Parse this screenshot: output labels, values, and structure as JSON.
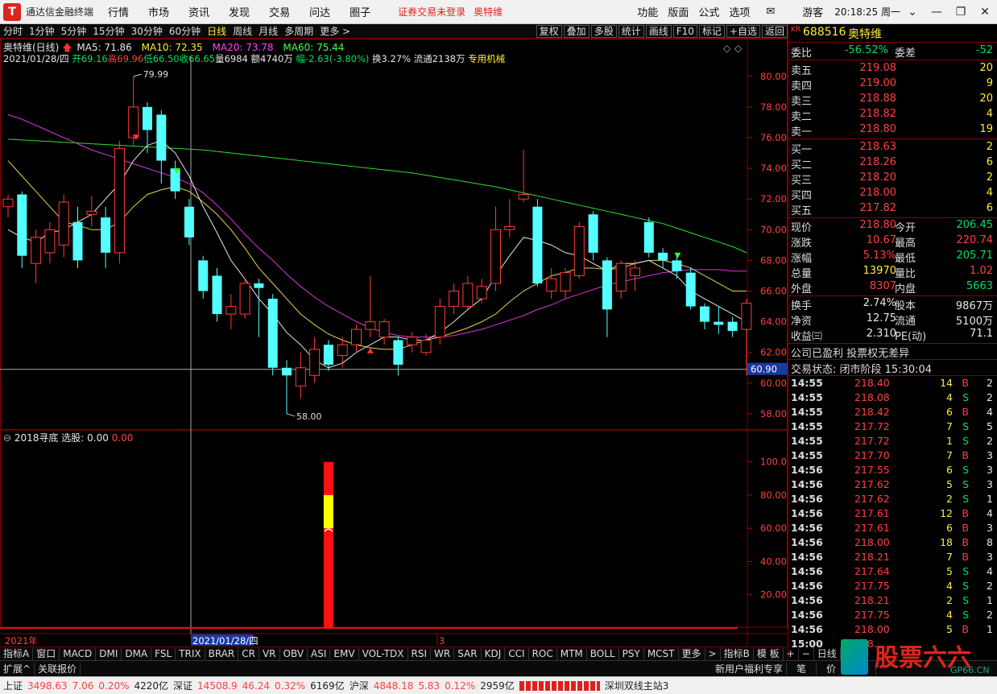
{
  "app": {
    "title": "通达信金融终端",
    "logo_letter": "T"
  },
  "menu": [
    "行情",
    "市场",
    "资讯",
    "发现",
    "交易",
    "问达",
    "圈子"
  ],
  "warning": "证券交易未登录",
  "warning_stock": "奥特维",
  "right_menu": [
    "功能",
    "版面",
    "公式",
    "选项"
  ],
  "mail_icon": "envelope-icon",
  "user": "游客",
  "clock": "20:18:25 周一",
  "toolbar": {
    "periods": [
      "分时",
      "1分钟",
      "5分钟",
      "15分钟",
      "30分钟",
      "60分钟",
      "日线",
      "周线",
      "月线",
      "多周期",
      "更多 >"
    ],
    "active": "日线",
    "right": [
      "复权",
      "叠加",
      "多股",
      "统计",
      "画线",
      "F10",
      "标记",
      "+自选",
      "返回"
    ]
  },
  "stock": {
    "code": "688516",
    "name": "奥特维",
    "badge": "KR",
    "title": "奥特维(日线)",
    "ma5": "MA5: 71.86",
    "ma10": "MA10: 72.35",
    "ma20": "MA20: 73.78",
    "ma60": "MA60: 75.44",
    "date": "2021/01/28/四",
    "open": "开69.16",
    "high": "高69.96",
    "low": "低66.50",
    "close": "收66.65",
    "vol": "量6984",
    "amount": "额4740万",
    "change": "幅-2.63(-3.80%)",
    "turnover": "换3.27%",
    "float": "流通2138万",
    "industry": "专用机械"
  },
  "price_axis": [
    "80.00",
    "78.00",
    "76.00",
    "74.00",
    "72.00",
    "70.00",
    "68.00",
    "66.00",
    "64.00",
    "62.00",
    "60.00",
    "58.00"
  ],
  "cursor_price": "60.90",
  "annot_high": "79.99",
  "annot_low": "58.00",
  "indicator": {
    "title": "2018寻底",
    "label": "选股: 0.00",
    "value": "0.00",
    "axis": [
      "100.0",
      "80.00",
      "60.00",
      "40.00",
      "20.00"
    ]
  },
  "time_axis": {
    "year": "2021年",
    "cursor_date": "2021/01/28/四",
    "marker": "3",
    "period": "日线"
  },
  "panel": {
    "weibi_label": "委比",
    "weibi": "-56.52%",
    "weicha_label": "委差",
    "weicha": "-52",
    "asks": [
      {
        "label": "卖五",
        "price": "219.08",
        "vol": "20"
      },
      {
        "label": "卖四",
        "price": "219.00",
        "vol": "9"
      },
      {
        "label": "卖三",
        "price": "218.88",
        "vol": "20"
      },
      {
        "label": "卖二",
        "price": "218.82",
        "vol": "4"
      },
      {
        "label": "卖一",
        "price": "218.80",
        "vol": "19"
      }
    ],
    "bids": [
      {
        "label": "买一",
        "price": "218.63",
        "vol": "2"
      },
      {
        "label": "买二",
        "price": "218.26",
        "vol": "6"
      },
      {
        "label": "买三",
        "price": "218.20",
        "vol": "2"
      },
      {
        "label": "买四",
        "price": "218.00",
        "vol": "4"
      },
      {
        "label": "买五",
        "price": "217.82",
        "vol": "6"
      }
    ],
    "stats": [
      {
        "l1": "现价",
        "v1": "218.80",
        "c1": "red",
        "l2": "今开",
        "v2": "206.45",
        "c2": "green"
      },
      {
        "l1": "涨跌",
        "v1": "10.67",
        "c1": "red",
        "l2": "最高",
        "v2": "220.74",
        "c2": "red"
      },
      {
        "l1": "涨幅",
        "v1": "5.13%",
        "c1": "red",
        "l2": "最低",
        "v2": "205.71",
        "c2": "green"
      },
      {
        "l1": "总量",
        "v1": "13970",
        "c1": "yellow",
        "l2": "量比",
        "v2": "1.02",
        "c2": "red"
      },
      {
        "l1": "外盘",
        "v1": "8307",
        "c1": "red",
        "l2": "内盘",
        "v2": "5663",
        "c2": "green"
      }
    ],
    "stats2": [
      {
        "l1": "换手",
        "v1": "2.74%",
        "l2": "股本",
        "v2": "9867万"
      },
      {
        "l1": "净资",
        "v1": "12.75",
        "l2": "流通",
        "v2": "5100万"
      },
      {
        "l1": "收益㈢",
        "v1": "2.310",
        "l2": "PE(动)",
        "v2": "71.1"
      }
    ],
    "profit_note": "公司已盈利 投票权无差异",
    "trade_state": "交易状态: 闭市阶段 15:30:04",
    "ticks": [
      {
        "t": "14:55",
        "p": "218.40",
        "v": "14",
        "s": "B",
        "n": "2"
      },
      {
        "t": "14:55",
        "p": "218.08",
        "v": "4",
        "s": "S",
        "n": "2"
      },
      {
        "t": "14:55",
        "p": "218.42",
        "v": "6",
        "s": "B",
        "n": "4"
      },
      {
        "t": "14:55",
        "p": "217.72",
        "v": "7",
        "s": "S",
        "n": "5"
      },
      {
        "t": "14:55",
        "p": "217.72",
        "v": "1",
        "s": "S",
        "n": "2"
      },
      {
        "t": "14:55",
        "p": "217.70",
        "v": "7",
        "s": "B",
        "n": "3"
      },
      {
        "t": "14:56",
        "p": "217.55",
        "v": "6",
        "s": "S",
        "n": "3"
      },
      {
        "t": "14:56",
        "p": "217.62",
        "v": "5",
        "s": "S",
        "n": "3"
      },
      {
        "t": "14:56",
        "p": "217.62",
        "v": "2",
        "s": "S",
        "n": "1"
      },
      {
        "t": "14:56",
        "p": "217.61",
        "v": "12",
        "s": "B",
        "n": "4"
      },
      {
        "t": "14:56",
        "p": "217.61",
        "v": "6",
        "s": "B",
        "n": "3"
      },
      {
        "t": "14:56",
        "p": "218.00",
        "v": "18",
        "s": "B",
        "n": "8"
      },
      {
        "t": "14:56",
        "p": "218.21",
        "v": "7",
        "s": "B",
        "n": "3"
      },
      {
        "t": "14:56",
        "p": "217.64",
        "v": "5",
        "s": "S",
        "n": "4"
      },
      {
        "t": "14:56",
        "p": "217.75",
        "v": "4",
        "s": "S",
        "n": "2"
      },
      {
        "t": "14:56",
        "p": "218.21",
        "v": "2",
        "s": "S",
        "n": "1"
      },
      {
        "t": "14:56",
        "p": "217.75",
        "v": "4",
        "s": "S",
        "n": "2"
      },
      {
        "t": "14:56",
        "p": "218.00",
        "v": "5",
        "s": "B",
        "n": "1"
      },
      {
        "t": "15:00",
        "p": "218.",
        "v": "",
        "s": "",
        "n": ""
      }
    ]
  },
  "tabs": [
    "指标A",
    "窗口",
    "MACD",
    "DMI",
    "DMA",
    "FSL",
    "TRIX",
    "BRAR",
    "CR",
    "VR",
    "OBV",
    "ASI",
    "EMV",
    "VOL-TDX",
    "RSI",
    "WR",
    "SAR",
    "KDJ",
    "CCI",
    "ROC",
    "MTM",
    "BOLL",
    "PSY",
    "MCST",
    "更多",
    ">",
    "指标B",
    "模 板",
    "+",
    "−"
  ],
  "tabs2": {
    "left": [
      "扩展^",
      "关联报价"
    ],
    "promo": "新用户福利专享",
    "right": [
      "笔",
      "价",
      "细"
    ]
  },
  "status": {
    "sh_label": "上证",
    "sh": "3498.63",
    "sh_chg": "7.06",
    "sh_pct": "0.20%",
    "sh_amt": "4220亿",
    "sz_label": "深证",
    "sz": "14508.9",
    "sz_chg": "46.24",
    "sz_pct": "0.32%",
    "sz_amt": "6169亿",
    "hs_label": "沪深",
    "hs": "4848.18",
    "hs_chg": "5.83",
    "hs_pct": "0.12%",
    "hs_amt": "2959亿",
    "server": "深圳双线主站3"
  },
  "watermark": {
    "text": "股票六六",
    "sub": "GP66.CN"
  },
  "chart_data": {
    "type": "candlestick",
    "price_range": [
      57,
      82
    ],
    "candles": [
      {
        "o": 71.5,
        "c": 72.0,
        "h": 72.3,
        "l": 70.8
      },
      {
        "o": 72.3,
        "c": 68.3,
        "h": 72.5,
        "l": 67.5
      },
      {
        "o": 67.8,
        "c": 69.5,
        "h": 70.0,
        "l": 66.5
      },
      {
        "o": 68.5,
        "c": 70.0,
        "h": 70.5,
        "l": 67.8
      },
      {
        "o": 69.0,
        "c": 71.8,
        "h": 72.3,
        "l": 68.2
      },
      {
        "o": 70.5,
        "c": 68.0,
        "h": 71.5,
        "l": 67.5
      },
      {
        "o": 71.0,
        "c": 71.2,
        "h": 72.2,
        "l": 70.2
      },
      {
        "o": 70.8,
        "c": 68.5,
        "h": 71.5,
        "l": 67.5
      },
      {
        "o": 68.5,
        "c": 75.3,
        "h": 75.8,
        "l": 67.8
      },
      {
        "o": 76.0,
        "c": 78.0,
        "h": 79.99,
        "l": 75.5
      },
      {
        "o": 78.0,
        "c": 76.5,
        "h": 78.3,
        "l": 75.0
      },
      {
        "o": 77.5,
        "c": 74.5,
        "h": 77.8,
        "l": 73.0
      },
      {
        "o": 74.0,
        "c": 72.5,
        "h": 74.5,
        "l": 72.0
      },
      {
        "o": 71.5,
        "c": 69.5,
        "h": 72.0,
        "l": 69.0
      },
      {
        "o": 68.0,
        "c": 66.0,
        "h": 68.3,
        "l": 65.5
      },
      {
        "o": 67.0,
        "c": 64.5,
        "h": 67.5,
        "l": 64.0
      },
      {
        "o": 64.5,
        "c": 65.0,
        "h": 65.8,
        "l": 63.5
      },
      {
        "o": 64.5,
        "c": 66.5,
        "h": 66.8,
        "l": 64.2
      },
      {
        "o": 66.5,
        "c": 66.2,
        "h": 66.8,
        "l": 63.0
      },
      {
        "o": 65.5,
        "c": 61.0,
        "h": 65.8,
        "l": 60.5
      },
      {
        "o": 61.0,
        "c": 60.5,
        "h": 61.5,
        "l": 58.0
      },
      {
        "o": 59.8,
        "c": 61.0,
        "h": 62.0,
        "l": 59.0
      },
      {
        "o": 60.5,
        "c": 62.2,
        "h": 63.0,
        "l": 60.0
      },
      {
        "o": 62.5,
        "c": 61.2,
        "h": 62.8,
        "l": 60.8
      },
      {
        "o": 61.8,
        "c": 62.5,
        "h": 63.0,
        "l": 61.0
      },
      {
        "o": 62.5,
        "c": 63.5,
        "h": 63.8,
        "l": 62.0
      },
      {
        "o": 63.5,
        "c": 64.0,
        "h": 67.0,
        "l": 63.0
      },
      {
        "o": 63.0,
        "c": 64.0,
        "h": 64.2,
        "l": 62.5
      },
      {
        "o": 62.8,
        "c": 61.2,
        "h": 63.0,
        "l": 60.5
      },
      {
        "o": 62.5,
        "c": 63.0,
        "h": 63.3,
        "l": 62.0
      },
      {
        "o": 62.0,
        "c": 62.8,
        "h": 63.2,
        "l": 61.8
      },
      {
        "o": 63.0,
        "c": 65.0,
        "h": 65.5,
        "l": 62.5
      },
      {
        "o": 65.0,
        "c": 66.0,
        "h": 66.5,
        "l": 64.5
      },
      {
        "o": 65.0,
        "c": 66.5,
        "h": 67.0,
        "l": 64.8
      },
      {
        "o": 65.5,
        "c": 66.3,
        "h": 66.8,
        "l": 65.2
      },
      {
        "o": 66.5,
        "c": 70.0,
        "h": 71.5,
        "l": 66.0
      },
      {
        "o": 70.0,
        "c": 70.2,
        "h": 72.0,
        "l": 69.5
      },
      {
        "o": 72.0,
        "c": 72.3,
        "h": 75.2,
        "l": 71.8
      },
      {
        "o": 71.5,
        "c": 66.5,
        "h": 72.0,
        "l": 66.3
      },
      {
        "o": 66.0,
        "c": 66.8,
        "h": 67.5,
        "l": 65.5
      },
      {
        "o": 66.0,
        "c": 67.2,
        "h": 67.5,
        "l": 65.5
      },
      {
        "o": 67.0,
        "c": 70.2,
        "h": 70.5,
        "l": 66.8
      },
      {
        "o": 71.0,
        "c": 68.5,
        "h": 71.2,
        "l": 68.0
      },
      {
        "o": 68.0,
        "c": 64.8,
        "h": 68.2,
        "l": 63.0
      },
      {
        "o": 66.0,
        "c": 67.8,
        "h": 68.0,
        "l": 65.5
      },
      {
        "o": 67.0,
        "c": 67.5,
        "h": 68.0,
        "l": 66.0
      },
      {
        "o": 70.5,
        "c": 68.5,
        "h": 70.8,
        "l": 68.2
      },
      {
        "o": 68.5,
        "c": 68.0,
        "h": 68.8,
        "l": 67.5
      },
      {
        "o": 68.0,
        "c": 67.3,
        "h": 68.3,
        "l": 66.8
      },
      {
        "o": 67.2,
        "c": 65.0,
        "h": 67.5,
        "l": 64.8
      },
      {
        "o": 65.0,
        "c": 64.0,
        "h": 65.2,
        "l": 63.5
      },
      {
        "o": 64.0,
        "c": 63.8,
        "h": 65.0,
        "l": 63.2
      },
      {
        "o": 64.0,
        "c": 63.4,
        "h": 64.3,
        "l": 63.0
      },
      {
        "o": 63.5,
        "c": 65.2,
        "h": 65.5,
        "l": 60.5
      }
    ],
    "ma5": [
      70.0,
      69.5,
      69.2,
      69.8,
      70.0,
      70.5,
      71.0,
      72.0,
      73.0,
      74.5,
      75.5,
      75.8,
      75.0,
      73.5,
      71.5,
      69.8,
      68.0,
      66.8,
      65.5,
      64.5,
      63.3,
      62.5,
      61.5,
      61.0,
      61.3,
      62.0,
      62.5,
      63.0,
      63.0,
      62.8,
      62.8,
      63.3,
      64.0,
      64.8,
      65.5,
      67.0,
      68.3,
      69.5,
      69.3,
      69.0,
      68.5,
      68.3,
      67.8,
      67.3,
      67.8,
      67.8,
      68.0,
      67.5,
      67.0,
      66.0,
      65.5,
      65.0,
      64.5,
      64.0
    ],
    "ma10": [
      74.5,
      73.5,
      72.5,
      71.5,
      70.5,
      70.3,
      70.0,
      70.0,
      70.5,
      71.5,
      72.3,
      72.6,
      72.8,
      72.5,
      71.8,
      71.0,
      70.0,
      68.8,
      67.5,
      66.5,
      65.5,
      64.5,
      63.8,
      63.2,
      62.8,
      62.5,
      62.3,
      62.2,
      62.2,
      62.5,
      62.8,
      63.0,
      63.3,
      63.6,
      64.0,
      64.5,
      65.3,
      66.0,
      66.5,
      67.0,
      67.2,
      67.5,
      67.5,
      67.4,
      67.5,
      67.8,
      68.0,
      68.0,
      67.8,
      67.5,
      67.0,
      66.5,
      66.0,
      66.0
    ],
    "ma20": [
      77.5,
      77.2,
      76.8,
      76.4,
      76.0,
      75.6,
      75.2,
      74.9,
      74.6,
      74.3,
      74.0,
      73.7,
      73.4,
      73.0,
      72.4,
      71.6,
      70.7,
      69.7,
      68.8,
      68.0,
      67.1,
      66.3,
      65.6,
      65.0,
      64.5,
      64.0,
      63.6,
      63.3,
      63.1,
      63.0,
      63.0,
      63.0,
      63.1,
      63.3,
      63.5,
      63.8,
      64.1,
      64.4,
      64.8,
      65.1,
      65.5,
      65.8,
      66.1,
      66.4,
      66.6,
      66.8,
      67.0,
      67.2,
      67.3,
      67.4,
      67.4,
      67.4,
      67.3,
      67.3
    ],
    "ma60": [
      75.9,
      75.85,
      75.8,
      75.75,
      75.7,
      75.65,
      75.6,
      75.55,
      75.5,
      75.45,
      75.4,
      75.35,
      75.3,
      75.25,
      75.2,
      75.1,
      75.0,
      74.9,
      74.8,
      74.7,
      74.6,
      74.5,
      74.4,
      74.3,
      74.2,
      74.1,
      74.0,
      73.9,
      73.8,
      73.7,
      73.55,
      73.4,
      73.25,
      73.1,
      72.95,
      72.8,
      72.6,
      72.4,
      72.2,
      72.0,
      71.8,
      71.6,
      71.4,
      71.2,
      71.0,
      70.8,
      70.6,
      70.4,
      70.1,
      69.8,
      69.5,
      69.2,
      68.9,
      68.5
    ],
    "indicator": {
      "bar_index": 23,
      "values": [
        100,
        80,
        60
      ]
    }
  }
}
